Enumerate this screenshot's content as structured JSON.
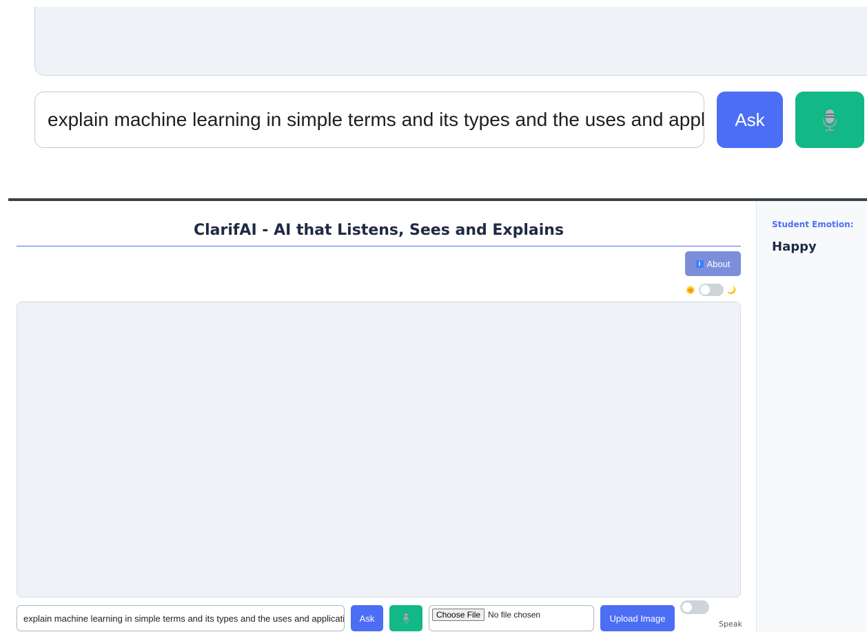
{
  "question": {
    "value": "explain machine learning in simple terms and its types and the uses and applications"
  },
  "buttons": {
    "ask_label": "Ask",
    "about_label": "About",
    "choose_file_label": "Choose File",
    "upload_label": "Upload Image"
  },
  "app": {
    "title": "ClarifAI - AI that Listens, Sees and Explains"
  },
  "file_input": {
    "status": "No file chosen"
  },
  "speak": {
    "label": "Speak"
  },
  "theme": {
    "light_icon": "sun-emoji",
    "dark_icon": "moon-emoji"
  },
  "sidebar": {
    "emotion_label": "Student Emotion:",
    "emotion_value": "Happy"
  },
  "colors": {
    "primary": "#4c6ef5",
    "mic": "#12b886",
    "about": "#7c8ed9",
    "chat_bg": "#eff2f7",
    "title": "#1f2a44"
  }
}
